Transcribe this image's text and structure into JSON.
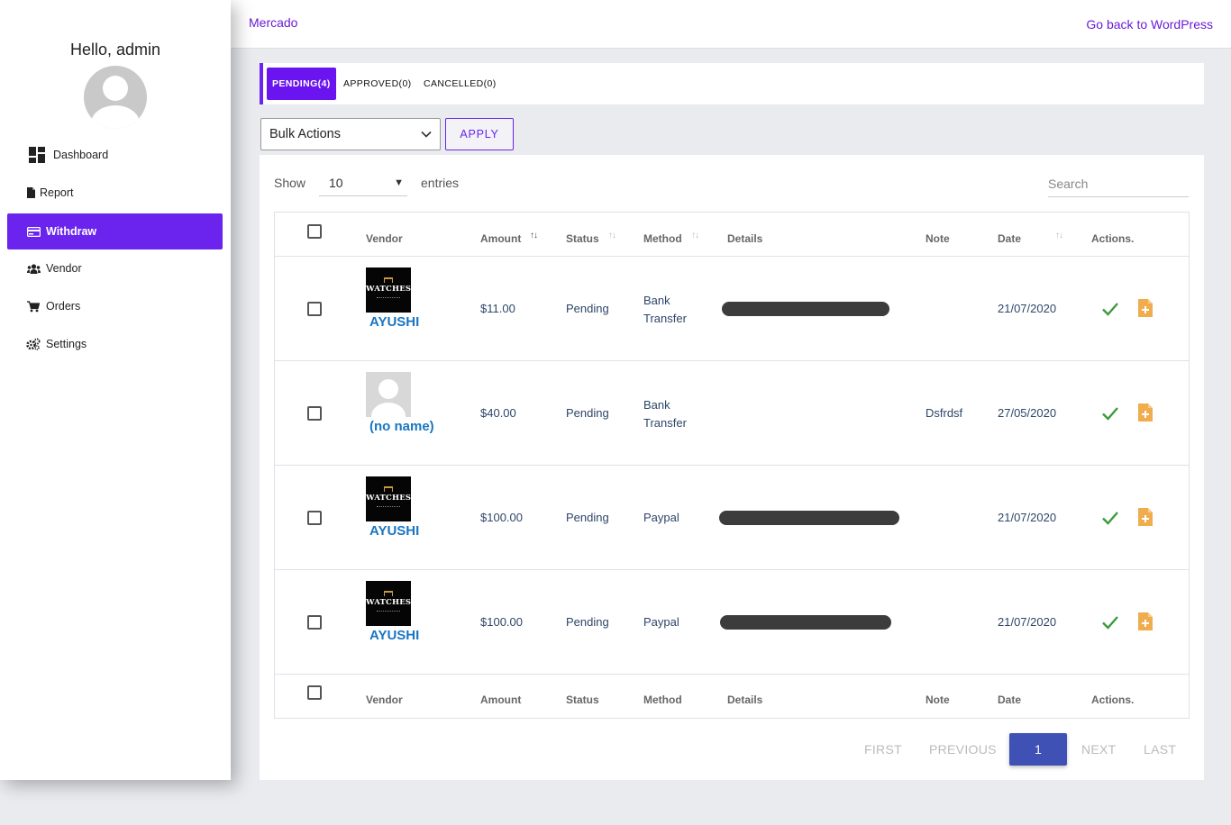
{
  "topbar": {
    "brand": "Mercado",
    "back_link": "Go back to WordPress"
  },
  "sidebar": {
    "greeting": "Hello, admin",
    "items": [
      {
        "label": "Dashboard",
        "icon": "dashboard-icon",
        "active": false
      },
      {
        "label": "Report",
        "icon": "file-icon",
        "active": false
      },
      {
        "label": "Withdraw",
        "icon": "credit-card-icon",
        "active": true
      },
      {
        "label": "Vendor",
        "icon": "users-icon",
        "active": false
      },
      {
        "label": "Orders",
        "icon": "cart-icon",
        "active": false
      },
      {
        "label": "Settings",
        "icon": "gears-icon",
        "active": false
      }
    ]
  },
  "tabs": [
    {
      "label": "PENDING(4)",
      "active": true
    },
    {
      "label": "APPROVED(0)",
      "active": false
    },
    {
      "label": "CANCELLED(0)",
      "active": false
    }
  ],
  "bulk": {
    "selected": "Bulk Actions",
    "apply_label": "APPLY"
  },
  "table_controls": {
    "show_label": "Show",
    "entries_value": "10",
    "entries_label": "entries",
    "search_placeholder": "Search"
  },
  "table": {
    "columns": [
      "Vendor",
      "Amount",
      "Status",
      "Method",
      "Details",
      "Note",
      "Date",
      "Actions."
    ],
    "rows": [
      {
        "vendor": "AYUSHI",
        "avatar": "logo",
        "amount": "$11.00",
        "status": "Pending",
        "method": "Bank Transfer",
        "details_redacted": true,
        "note": "",
        "date": "21/07/2020"
      },
      {
        "vendor": "(no name)",
        "avatar": "placeholder",
        "amount": "$40.00",
        "status": "Pending",
        "method": "Bank Transfer",
        "details_redacted": false,
        "note": "Dsfrdsf",
        "date": "27/05/2020"
      },
      {
        "vendor": "AYUSHI",
        "avatar": "logo",
        "amount": "$100.00",
        "status": "Pending",
        "method": "Paypal",
        "details_redacted": true,
        "note": "",
        "date": "21/07/2020"
      },
      {
        "vendor": "AYUSHI",
        "avatar": "logo",
        "amount": "$100.00",
        "status": "Pending",
        "method": "Paypal",
        "details_redacted": true,
        "note": "",
        "date": "21/07/2020"
      }
    ],
    "logo_text": "WATCHES"
  },
  "pagination": {
    "first": "FIRST",
    "previous": "PREVIOUS",
    "current": "1",
    "next": "NEXT",
    "last": "LAST"
  },
  "colors": {
    "accent": "#6a24ee",
    "link": "#1976c2",
    "page_button": "#3f51b5",
    "approve": "#3c9a3c",
    "note_icon": "#f0ad4e"
  }
}
